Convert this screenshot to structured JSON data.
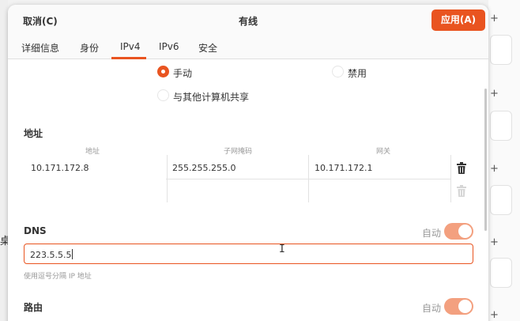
{
  "header": {
    "cancel_label": "取消(C)",
    "title": "有线",
    "apply_label": "应用(A)"
  },
  "tabs": [
    {
      "label": "详细信息",
      "active": false
    },
    {
      "label": "身份",
      "active": false
    },
    {
      "label": "IPv4",
      "active": true
    },
    {
      "label": "IPv6",
      "active": false
    },
    {
      "label": "安全",
      "active": false
    }
  ],
  "method": {
    "options": [
      {
        "label": "手动",
        "selected": true
      },
      {
        "label": "禁用",
        "selected": false
      },
      {
        "label": "与其他计算机共享",
        "selected": false
      }
    ]
  },
  "addresses": {
    "title": "地址",
    "columns": [
      "地址",
      "子网掩码",
      "网关"
    ],
    "rows": [
      {
        "address": "10.171.172.8",
        "netmask": "255.255.255.0",
        "gateway": "10.171.172.1"
      },
      {
        "address": "",
        "netmask": "",
        "gateway": ""
      }
    ]
  },
  "dns": {
    "title": "DNS",
    "auto_label": "自动",
    "auto_enabled": true,
    "value": "223.5.5.5",
    "hint": "使用逗号分隔 IP 地址"
  },
  "routes": {
    "title": "路由",
    "auto_label": "自动",
    "auto_enabled": true
  },
  "background": {
    "partial_char": "桌"
  },
  "colors": {
    "accent": "#e95420",
    "toggle_on": "#f3a07f"
  },
  "icons": {
    "delete": "trash-icon",
    "text_cursor": "i-beam-cursor-icon"
  }
}
